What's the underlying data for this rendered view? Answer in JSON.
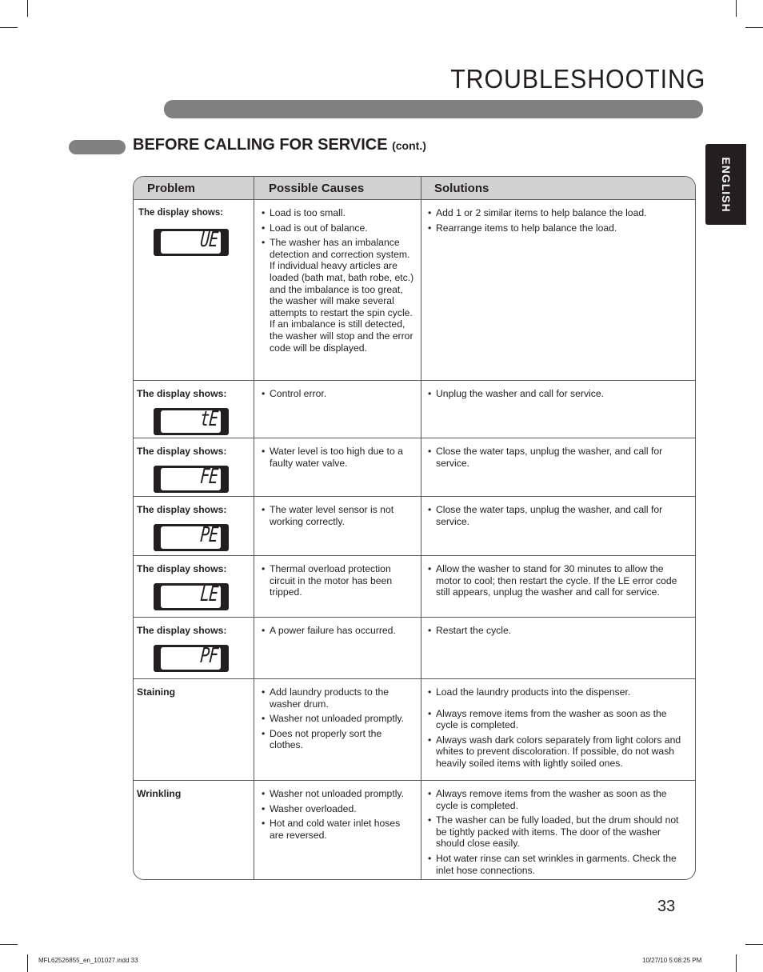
{
  "header": {
    "page_title": "TROUBLESHOOTING",
    "section_title": "BEFORE CALLING FOR SERVICE",
    "section_suffix": "(cont.)",
    "language_tab": "ENGLISH"
  },
  "table": {
    "columns": [
      "Problem",
      "Possible Causes",
      "Solutions"
    ],
    "rows": [
      {
        "problem": "The display shows:",
        "display_code": "UE",
        "causes": [
          "Load is too small.",
          "Load is out of balance.",
          "The washer has an imbalance detection and correction system. If individual heavy articles are loaded (bath mat, bath robe, etc.) and the imbalance is too great, the washer will make several attempts to restart the spin cycle. If an imbalance is still detected, the washer will stop and the error code will be displayed."
        ],
        "solutions": [
          "Add 1 or 2 similar items to help balance the load.",
          "Rearrange items to help balance the load."
        ]
      },
      {
        "problem": "The display shows:",
        "display_code": "tE",
        "causes": [
          "Control error."
        ],
        "solutions": [
          "Unplug the washer and call for service."
        ]
      },
      {
        "problem": "The display shows:",
        "display_code": "FE",
        "causes": [
          "Water level is too high due to a faulty water valve."
        ],
        "solutions": [
          "Close the water taps, unplug the washer, and call for service."
        ]
      },
      {
        "problem": "The display shows:",
        "display_code": "PE",
        "causes": [
          "The water level sensor is not working correctly."
        ],
        "solutions": [
          "Close the water taps, unplug the washer, and call for service."
        ]
      },
      {
        "problem": "The display shows:",
        "display_code": "LE",
        "causes": [
          "Thermal overload protection circuit in the motor has been tripped."
        ],
        "solutions": [
          "Allow the washer to stand for 30 minutes to allow the motor to cool; then restart the cycle. If the LE error code still appears, unplug the washer and call for service."
        ]
      },
      {
        "problem": "The display shows:",
        "display_code": "PF",
        "causes": [
          "A power failure has occurred."
        ],
        "solutions": [
          "Restart the cycle."
        ]
      },
      {
        "problem": "Staining",
        "causes": [
          "Add laundry products to the washer drum.",
          "Washer not unloaded promptly.",
          "Does not properly sort the clothes."
        ],
        "solutions": [
          "Load the laundry products into the dispenser.",
          "Always remove items from the washer as soon as the cycle is completed.",
          "Always wash dark colors separately from light colors and whites to prevent discoloration. If possible, do not wash heavily soiled items with lightly soiled ones."
        ]
      },
      {
        "problem": "Wrinkling",
        "causes": [
          "Washer not unloaded promptly.",
          "Washer overloaded.",
          "Hot and cold water inlet hoses are reversed."
        ],
        "solutions": [
          "Always remove items from the washer as soon as the cycle is completed.",
          "The washer can be fully loaded, but the drum should not be tightly packed with items. The door of the washer should close easily.",
          "Hot water rinse can set wrinkles in garments. Check the inlet hose connections."
        ]
      }
    ]
  },
  "footer": {
    "page_number": "33",
    "file_info": "MFL62526855_en_101027.indd   33",
    "timestamp": "10/27/10   5:08:25 PM"
  }
}
